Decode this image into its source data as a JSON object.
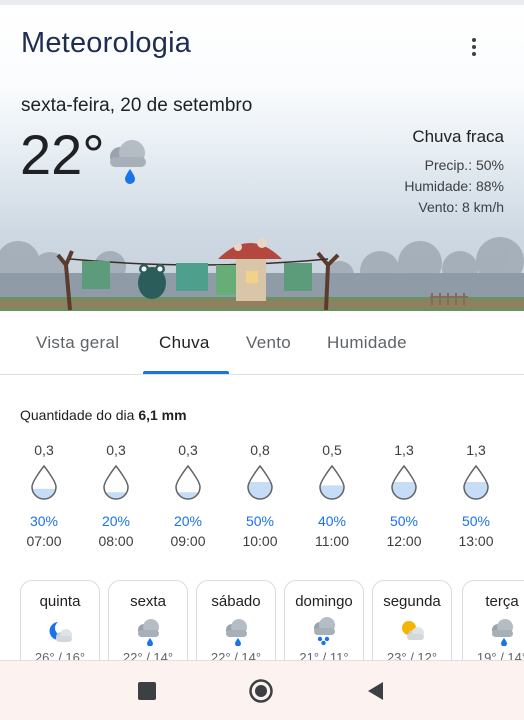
{
  "app": {
    "title": "Meteorologia"
  },
  "current": {
    "date": "sexta-feira, 20 de setembro",
    "temperature": "22°",
    "icon": "cloud-rain-icon",
    "condition": "Chuva fraca",
    "precip": "Precip.: 50%",
    "humidity": "Humidade: 88%",
    "wind": "Vento: 8 km/h"
  },
  "tabs": [
    {
      "label": "Vista geral",
      "active": false
    },
    {
      "label": "Chuva",
      "active": true
    },
    {
      "label": "Vento",
      "active": false
    },
    {
      "label": "Humidade",
      "active": false
    }
  ],
  "daily_amount": {
    "label": "Quantidade do dia",
    "value": "6,1 mm"
  },
  "hourly": [
    {
      "amount": "0,3",
      "chance": "30%",
      "time": "07:00",
      "fill": 0.3
    },
    {
      "amount": "0,3",
      "chance": "20%",
      "time": "08:00",
      "fill": 0.2
    },
    {
      "amount": "0,3",
      "chance": "20%",
      "time": "09:00",
      "fill": 0.2
    },
    {
      "amount": "0,8",
      "chance": "50%",
      "time": "10:00",
      "fill": 0.5
    },
    {
      "amount": "0,5",
      "chance": "40%",
      "time": "11:00",
      "fill": 0.4
    },
    {
      "amount": "1,3",
      "chance": "50%",
      "time": "12:00",
      "fill": 0.5
    },
    {
      "amount": "1,3",
      "chance": "50%",
      "time": "13:00",
      "fill": 0.5
    }
  ],
  "days": [
    {
      "name": "quinta",
      "icon": "moon-cloud-icon",
      "range": "26° / 16°"
    },
    {
      "name": "sexta",
      "icon": "cloud-rain-icon",
      "range": "22° / 14°"
    },
    {
      "name": "sábado",
      "icon": "cloud-rain-icon",
      "range": "22° / 14°"
    },
    {
      "name": "domingo",
      "icon": "cloud-heavy-rain-icon",
      "range": "21° / 11°"
    },
    {
      "name": "segunda",
      "icon": "sun-cloud-icon",
      "range": "23° / 12°"
    },
    {
      "name": "terça",
      "icon": "cloud-rain-icon",
      "range": "19° / 14°"
    }
  ],
  "colors": {
    "accent": "#1a73e8",
    "title": "#1f2d52",
    "drop_fill": "#c7dcf7"
  }
}
